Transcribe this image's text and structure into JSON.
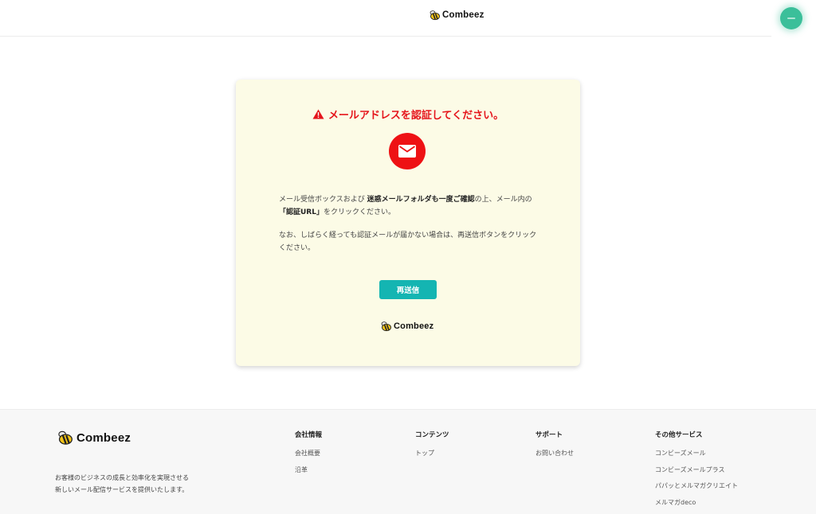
{
  "brand": {
    "name": "Combeez"
  },
  "card": {
    "title": "メールアドレスを認証してください。",
    "p1_before": "メール受信ボックスおよび ",
    "p1_bold": "迷惑メールフォルダも一度ご確認",
    "p1_after": "の上、メール内の",
    "p1_bold2": "「認証URL」",
    "p1_end": "をクリックください。",
    "p2": "なお、しばらく経っても認証メールが届かない場合は、再送信ボタンをクリックください。",
    "resend_label": "再送信"
  },
  "footer": {
    "tagline_line1": "お客様のビジネスの成長と効率化を実現させる",
    "tagline_line2": "新しいメール配信サービスを提供いたします。",
    "columns": [
      {
        "title": "会社情報",
        "links": [
          "会社概要",
          "沿革"
        ]
      },
      {
        "title": "コンテンツ",
        "links": [
          "トップ"
        ]
      },
      {
        "title": "サポート",
        "links": [
          "お問い合わせ"
        ]
      },
      {
        "title": "その他サービス",
        "links": [
          "コンビーズメール",
          "コンビーズメールプラス",
          "パパッとメルマガクリエイト",
          "メルマガdeco"
        ]
      }
    ]
  },
  "colors": {
    "accent_red": "#e5141b",
    "button_teal": "#14b5b2",
    "card_bg": "#fcfbe6",
    "fab_green": "#3bbf9a"
  },
  "icons": [
    "bee-logo-icon",
    "warning-icon",
    "mail-icon",
    "chat-fab-icon"
  ]
}
